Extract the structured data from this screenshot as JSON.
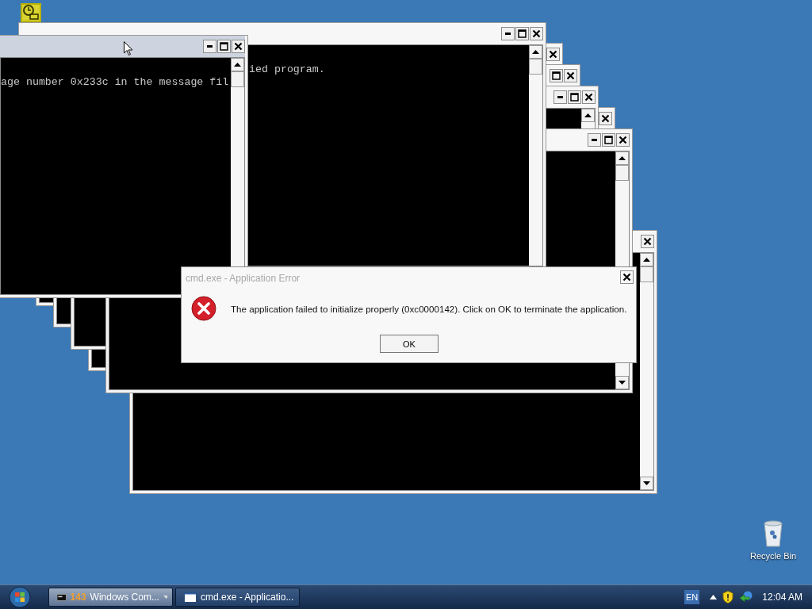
{
  "console_windows": [
    {
      "lines": [
        "ied program."
      ]
    },
    {
      "lines": [
        "age number 0x233c in the message fil"
      ]
    }
  ],
  "dialog": {
    "title": "cmd.exe - Application Error",
    "message": "The application failed to initialize properly (0xc0000142). Click on OK to terminate the application.",
    "button": "OK"
  },
  "recycle_bin": {
    "label": "Recycle Bin"
  },
  "taskbar": {
    "buttons": [
      {
        "badge": "143",
        "label": "Windows Com...",
        "selected": true
      },
      {
        "label": "cmd.exe - Applicatio...",
        "selected": false
      }
    ],
    "language": "EN",
    "clock": "12:04 AM"
  }
}
